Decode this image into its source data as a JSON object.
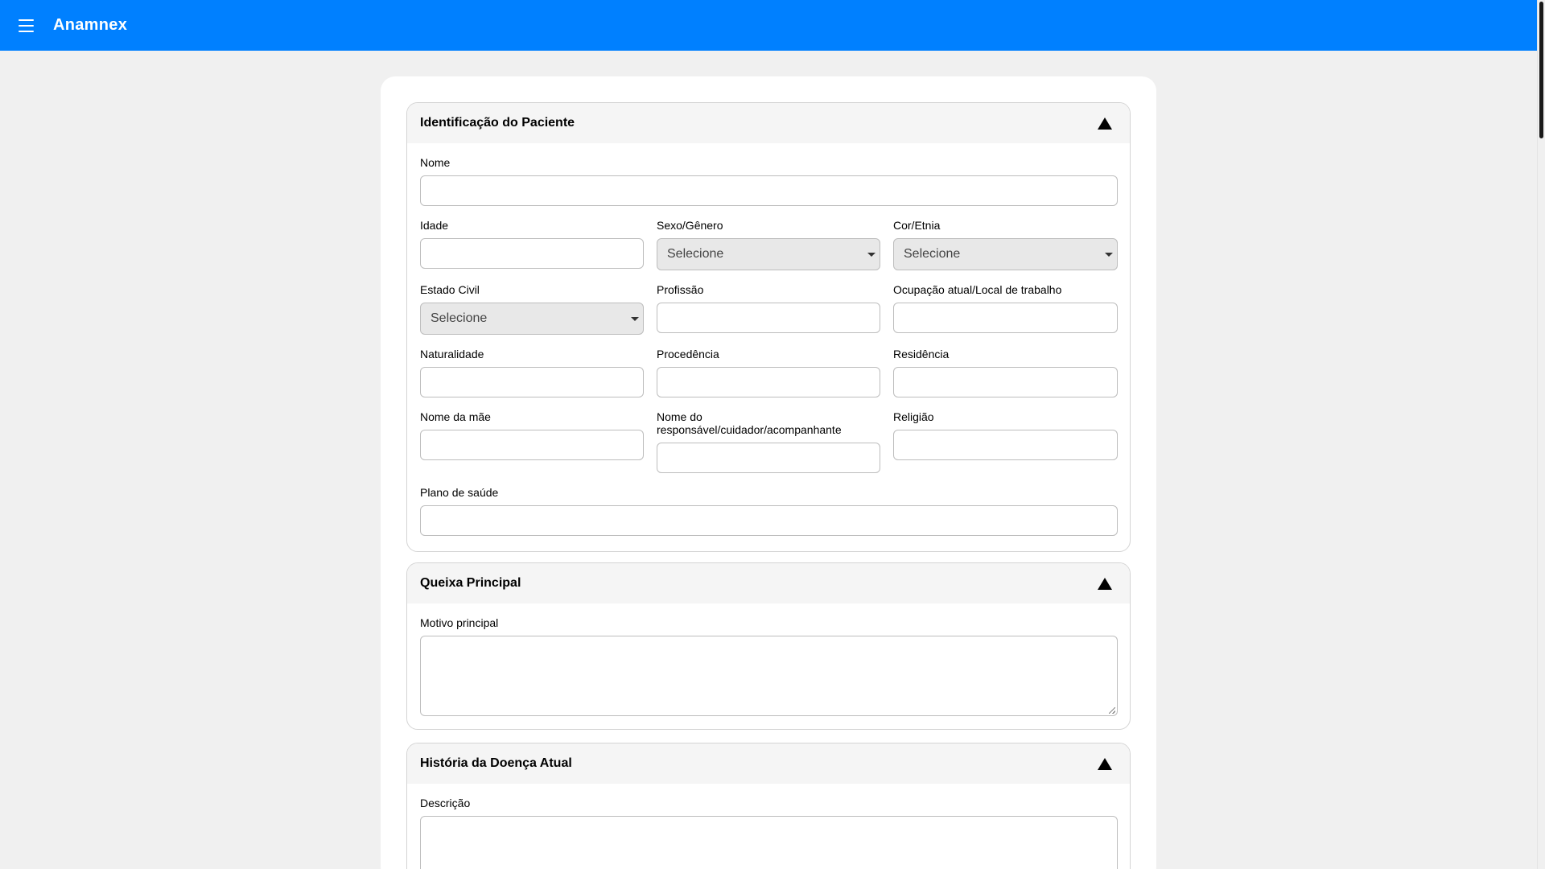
{
  "app": {
    "title": "Anamnex"
  },
  "sections": {
    "identificacao": {
      "title": "Identificação do Paciente",
      "fields": {
        "nome": "Nome",
        "idade": "Idade",
        "sexo": "Sexo/Gênero",
        "cor": "Cor/Etnia",
        "estado_civil": "Estado Civil",
        "profissao": "Profissão",
        "ocupacao": "Ocupação atual/Local de trabalho",
        "naturalidade": "Naturalidade",
        "procedencia": "Procedência",
        "residencia": "Residência",
        "nome_mae": "Nome da mãe",
        "nome_responsavel_line1": "Nome do",
        "nome_responsavel_line2": "responsável/cuidador/acompanhante",
        "religiao": "Religião",
        "plano_saude": "Plano de saúde"
      },
      "selects": {
        "sexo": "Selecione",
        "cor": "Selecione",
        "estado_civil": "Selecione"
      }
    },
    "queixa": {
      "title": "Queixa Principal",
      "fields": {
        "motivo": "Motivo principal"
      }
    },
    "historia": {
      "title": "História da Doença Atual",
      "fields": {
        "descricao": "Descrição"
      }
    }
  }
}
